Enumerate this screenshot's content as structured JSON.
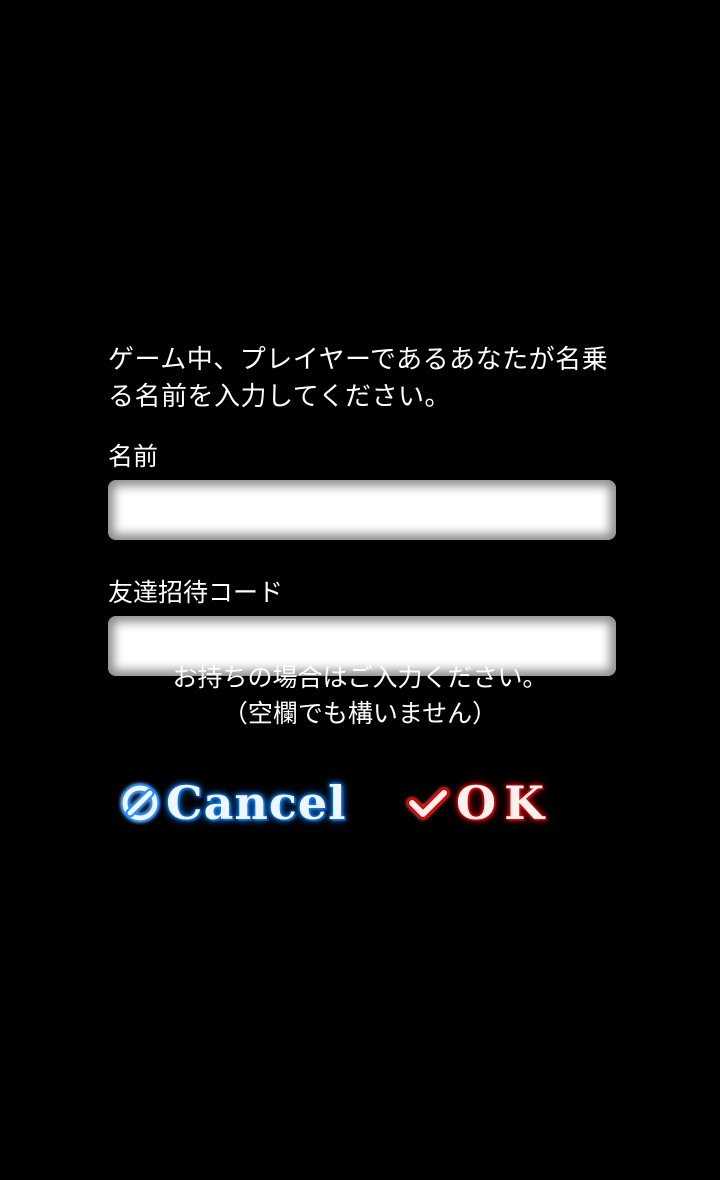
{
  "form": {
    "instruction": "ゲーム中、プレイヤーであるあなたが名乗る名前を入力してください。",
    "name_label": "名前",
    "name_value": "",
    "invite_label": "友達招待コード",
    "invite_value": "",
    "hint_line1": "お持ちの場合はご入力ください。",
    "hint_line2": "（空欄でも構いません）"
  },
  "actions": {
    "cancel_label": "Cancel",
    "ok_label": "OK",
    "cancel_icon": "slashed-circle-icon",
    "ok_icon": "checkmark-icon"
  },
  "colors": {
    "background": "#000000",
    "text": "#ffffff",
    "cancel_glow": "#1a8cff",
    "ok_glow": "#e00000"
  }
}
